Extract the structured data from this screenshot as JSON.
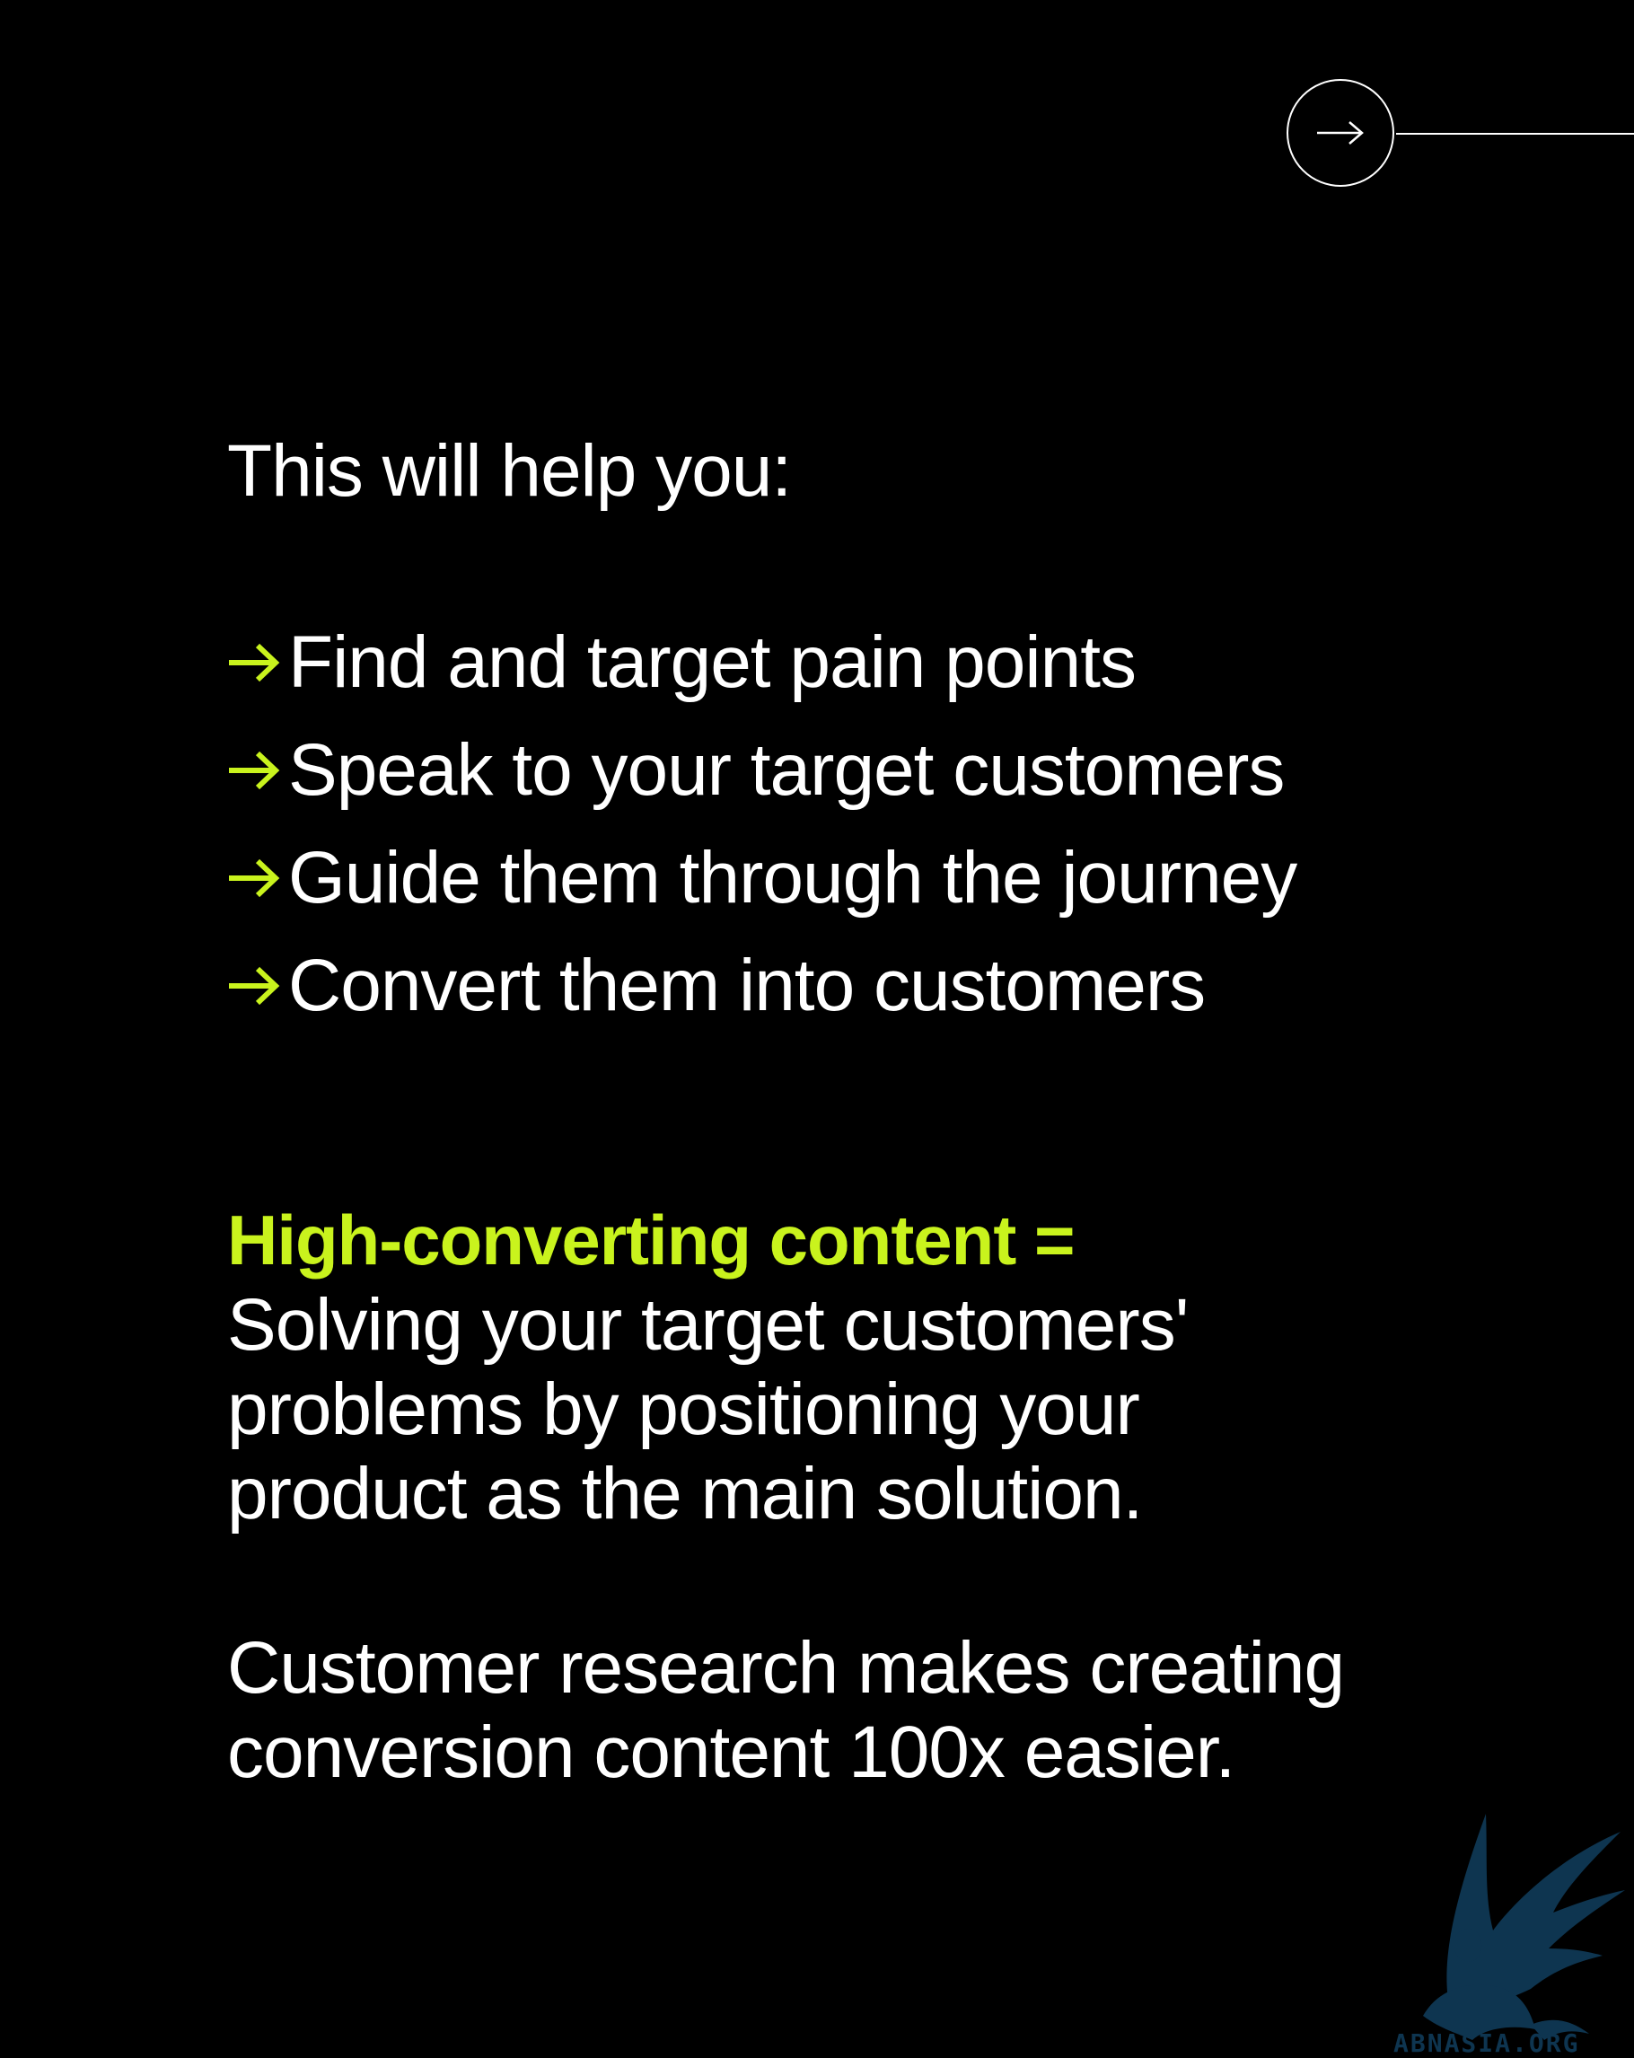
{
  "colors": {
    "background": "#000000",
    "text": "#ffffff",
    "accent": "#c9f31d",
    "watermark": "#0e3550"
  },
  "nav": {
    "next_icon": "arrow-right-icon"
  },
  "intro": "This will help you:",
  "bullets": [
    {
      "icon": "arrow-right-icon",
      "text": "Find and target pain points"
    },
    {
      "icon": "arrow-right-icon",
      "text": "Speak to your target customers"
    },
    {
      "icon": "arrow-right-icon",
      "text": "Guide them through the journey"
    },
    {
      "icon": "arrow-right-icon",
      "text": "Convert them into customers"
    }
  ],
  "equation": {
    "title": "High-converting content =",
    "text": "Solving your target customers' problems by positioning your product as the main solution."
  },
  "closing": "Customer research makes creating conversion content 100x easier.",
  "watermark": {
    "icon": "griffin-logo-icon",
    "text": "ABNASIA.ORG"
  }
}
